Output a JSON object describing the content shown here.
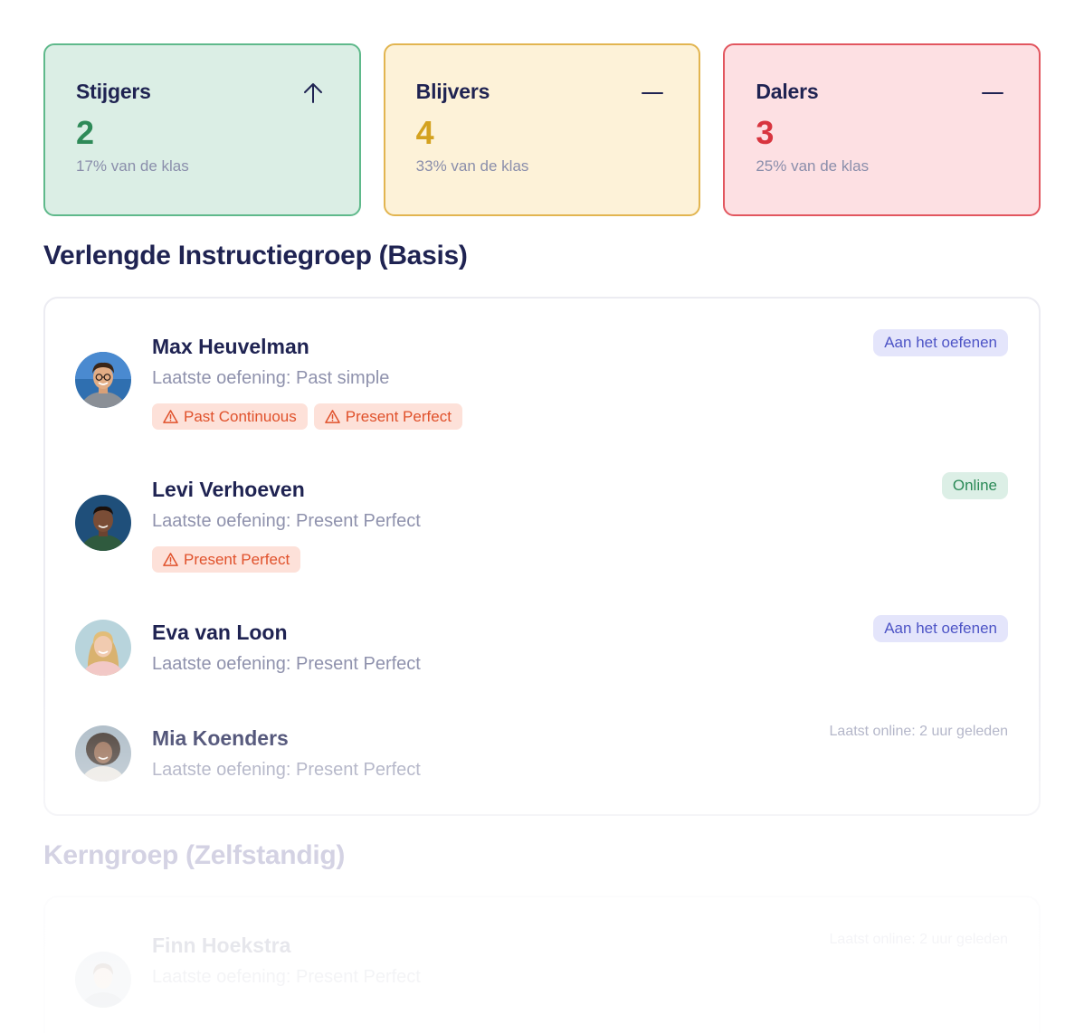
{
  "stats": [
    {
      "title": "Stijgers",
      "value": "2",
      "sub": "17% van de klas",
      "icon": "arrow-up-icon"
    },
    {
      "title": "Blijvers",
      "value": "4",
      "sub": "33% van de klas",
      "icon": "minus-icon"
    },
    {
      "title": "Dalers",
      "value": "3",
      "sub": "25% van de klas",
      "icon": "minus-icon"
    }
  ],
  "groups": [
    {
      "title": "Verlengde Instructiegroep (Basis)",
      "students": [
        {
          "name": "Max Heuvelman",
          "exercise": "Laatste oefening: Past simple",
          "tags": [
            "Past Continuous",
            "Present Perfect"
          ],
          "status": "Aan het oefenen"
        },
        {
          "name": "Levi Verhoeven",
          "exercise": "Laatste oefening: Present Perfect",
          "tags": [
            "Present Perfect"
          ],
          "status": "Online"
        },
        {
          "name": "Eva van Loon",
          "exercise": "Laatste oefening: Present Perfect",
          "tags": [],
          "status": "Aan het oefenen"
        },
        {
          "name": "Mia Koenders",
          "exercise": "Laatste oefening: Present Perfect",
          "tags": [],
          "status": "Laatst online: 2 uur geleden"
        }
      ]
    },
    {
      "title": "Kerngroep (Zelfstandig)",
      "students": [
        {
          "name": "Finn Hoekstra",
          "exercise": "Laatste oefening: Present Perfect",
          "tags": [],
          "status": "Laatst online: 2 uur geleden"
        }
      ]
    }
  ],
  "colors": {
    "up": "#2e8a58",
    "same": "#d4a21f",
    "down": "#d8353f",
    "practicing_badge": "#4d54c6",
    "online_badge": "#2b8a57",
    "warning_tag": "#e0512b"
  }
}
